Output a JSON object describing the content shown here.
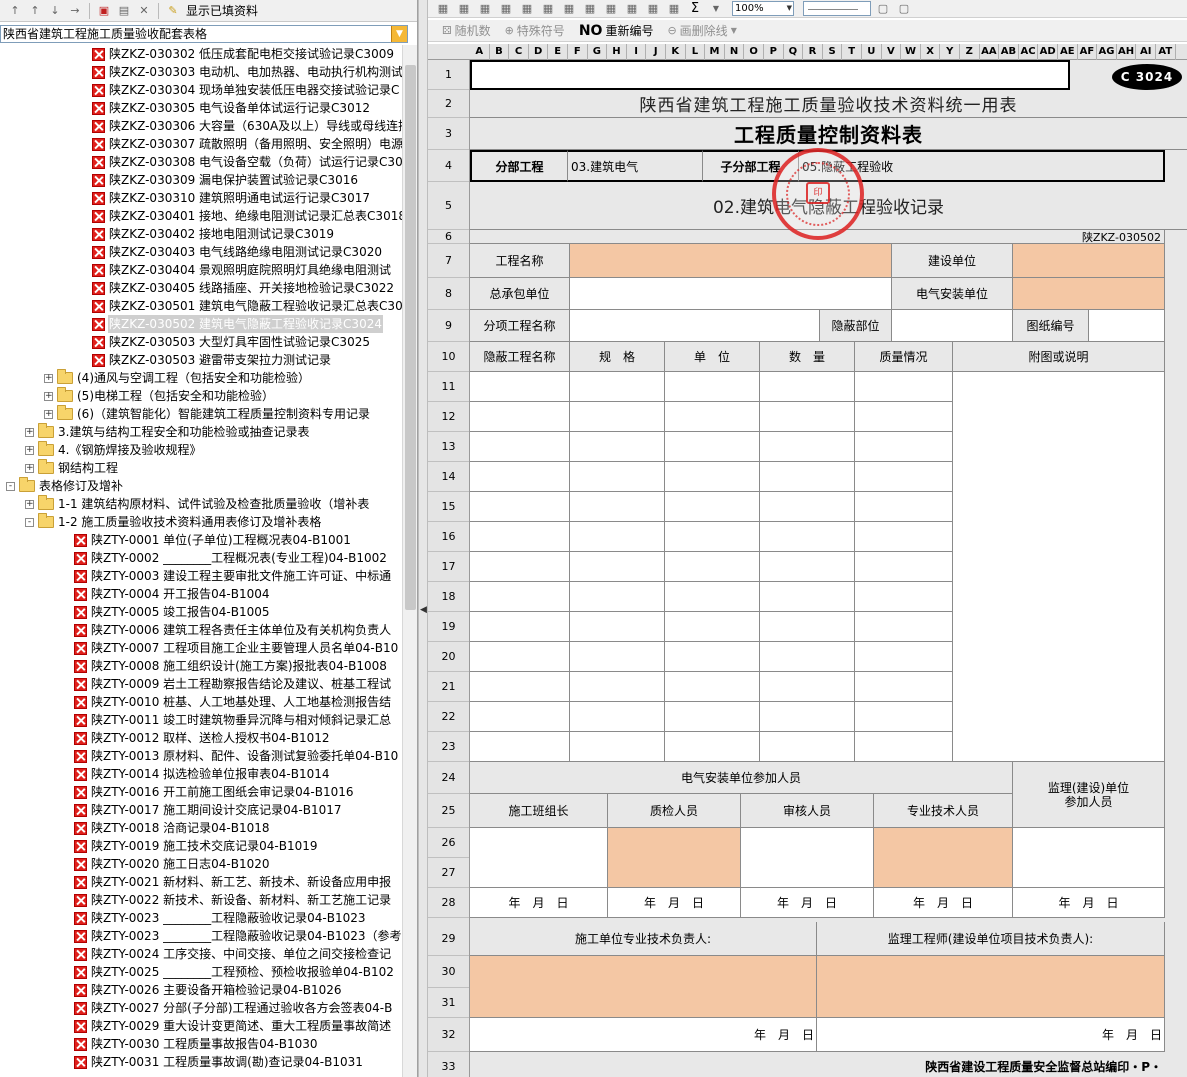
{
  "left_toolbar": {
    "show_filled_label": "显示已填资料"
  },
  "left_combo": {
    "value": "陕西省建筑工程施工质量验收配套表格"
  },
  "tree": {
    "rows": [
      {
        "kind": "doc",
        "indent": 92,
        "label": "陕ZKZ-030302 低压成套配电柜交接试验记录C3009"
      },
      {
        "kind": "doc",
        "indent": 92,
        "label": "陕ZKZ-030303 电动机、电加热器、电动执行机构测试"
      },
      {
        "kind": "doc",
        "indent": 92,
        "label": "陕ZKZ-030304 现场单独安装低压电器交接试验记录C"
      },
      {
        "kind": "doc",
        "indent": 92,
        "label": "陕ZKZ-030305 电气设备单体试运行记录C3012"
      },
      {
        "kind": "doc",
        "indent": 92,
        "label": "陕ZKZ-030306 大容量（630A及以上）导线或母线连接"
      },
      {
        "kind": "doc",
        "indent": 92,
        "label": "陕ZKZ-030307 疏散照明（备用照明、安全照明）电源"
      },
      {
        "kind": "doc",
        "indent": 92,
        "label": "陕ZKZ-030308 电气设备空载（负荷）试运行记录C30"
      },
      {
        "kind": "doc",
        "indent": 92,
        "label": "陕ZKZ-030309 漏电保护装置试验记录C3016"
      },
      {
        "kind": "doc",
        "indent": 92,
        "label": "陕ZKZ-030310 建筑照明通电试运行记录C3017"
      },
      {
        "kind": "doc",
        "indent": 92,
        "label": "陕ZKZ-030401 接地、绝缘电阻测试记录汇总表C3018"
      },
      {
        "kind": "doc",
        "indent": 92,
        "label": "陕ZKZ-030402 接地电阻测试记录C3019"
      },
      {
        "kind": "doc",
        "indent": 92,
        "label": "陕ZKZ-030403 电气线路绝缘电阻测试记录C3020"
      },
      {
        "kind": "doc",
        "indent": 92,
        "label": "陕ZKZ-030404 景观照明庭院照明灯具绝缘电阻测试"
      },
      {
        "kind": "doc",
        "indent": 92,
        "label": "陕ZKZ-030405 线路插座、开关接地检验记录C3022"
      },
      {
        "kind": "doc",
        "indent": 92,
        "label": "陕ZKZ-030501 建筑电气隐蔽工程验收记录汇总表C30"
      },
      {
        "kind": "doc",
        "indent": 92,
        "label": "陕ZKZ-030502 建筑电气隐蔽工程验收记录C3024",
        "selected": true
      },
      {
        "kind": "doc",
        "indent": 92,
        "label": "陕ZKZ-030503 大型灯具牢固性试验记录C3025"
      },
      {
        "kind": "doc",
        "indent": 92,
        "label": "陕ZKZ-030503 避雷带支架拉力测试记录"
      },
      {
        "kind": "folder",
        "indent": 58,
        "label": "(4)通风与空调工程（包括安全和功能检验）",
        "expander": "+"
      },
      {
        "kind": "folder",
        "indent": 58,
        "label": "(5)电梯工程（包括安全和功能检验）",
        "expander": "+"
      },
      {
        "kind": "folder",
        "indent": 58,
        "label": "(6)（建筑智能化）智能建筑工程质量控制资料专用记录",
        "expander": "+"
      },
      {
        "kind": "folder",
        "indent": 39,
        "label": "3.建筑与结构工程安全和功能检验或抽查记录表",
        "expander": "+"
      },
      {
        "kind": "folder",
        "indent": 39,
        "label": "4.《钢筋焊接及验收规程》",
        "expander": "+"
      },
      {
        "kind": "folder",
        "indent": 39,
        "label": "钢结构工程",
        "expander": "+"
      },
      {
        "kind": "folder-open",
        "indent": 20,
        "label": "表格修订及增补",
        "expander": "-"
      },
      {
        "kind": "folder",
        "indent": 39,
        "label": "1-1 建筑结构原材料、试件试验及检查批质量验收（增补表",
        "expander": "+"
      },
      {
        "kind": "folder-open",
        "indent": 39,
        "label": "1-2 施工质量验收技术资料通用表修订及增补表格",
        "expander": "-"
      },
      {
        "kind": "doc",
        "indent": 74,
        "label": "陕ZTY-0001 单位(子单位)工程概况表04-B1001"
      },
      {
        "kind": "doc",
        "indent": 74,
        "label": "陕ZTY-0002 ________工程概况表(专业工程)04-B1002"
      },
      {
        "kind": "doc",
        "indent": 74,
        "label": "陕ZTY-0003 建设工程主要审批文件施工许可证、中标通"
      },
      {
        "kind": "doc",
        "indent": 74,
        "label": "陕ZTY-0004 开工报告04-B1004"
      },
      {
        "kind": "doc",
        "indent": 74,
        "label": "陕ZTY-0005 竣工报告04-B1005"
      },
      {
        "kind": "doc",
        "indent": 74,
        "label": "陕ZTY-0006 建筑工程各责任主体单位及有关机构负责人"
      },
      {
        "kind": "doc",
        "indent": 74,
        "label": "陕ZTY-0007 工程项目施工企业主要管理人员名单04-B10"
      },
      {
        "kind": "doc",
        "indent": 74,
        "label": "陕ZTY-0008 施工组织设计(施工方案)报批表04-B1008"
      },
      {
        "kind": "doc",
        "indent": 74,
        "label": "陕ZTY-0009 岩土工程勘察报告结论及建议、桩基工程试"
      },
      {
        "kind": "doc",
        "indent": 74,
        "label": "陕ZTY-0010 桩基、人工地基处理、人工地基检测报告结"
      },
      {
        "kind": "doc",
        "indent": 74,
        "label": "陕ZTY-0011 竣工时建筑物垂异沉降与相对倾斜记录汇总"
      },
      {
        "kind": "doc",
        "indent": 74,
        "label": "陕ZTY-0012 取样、送检人授权书04-B1012"
      },
      {
        "kind": "doc",
        "indent": 74,
        "label": "陕ZTY-0013 原材料、配件、设备测试复验委托单04-B10"
      },
      {
        "kind": "doc",
        "indent": 74,
        "label": "陕ZTY-0014 拟选检验单位报审表04-B1014"
      },
      {
        "kind": "doc",
        "indent": 74,
        "label": "陕ZTY-0016 开工前施工图纸会审记录04-B1016"
      },
      {
        "kind": "doc",
        "indent": 74,
        "label": "陕ZTY-0017 施工期间设计交底记录04-B1017"
      },
      {
        "kind": "doc",
        "indent": 74,
        "label": "陕ZTY-0018 洽商记录04-B1018"
      },
      {
        "kind": "doc",
        "indent": 74,
        "label": "陕ZTY-0019 施工技术交底记录04-B1019"
      },
      {
        "kind": "doc",
        "indent": 74,
        "label": "陕ZTY-0020 施工日志04-B1020"
      },
      {
        "kind": "doc",
        "indent": 74,
        "label": "陕ZTY-0021 新材料、新工艺、新技术、新设备应用申报"
      },
      {
        "kind": "doc",
        "indent": 74,
        "label": "陕ZTY-0022 新技术、新设备、新材料、新工艺施工记录"
      },
      {
        "kind": "doc",
        "indent": 74,
        "label": "陕ZTY-0023 ________工程隐蔽验收记录04-B1023"
      },
      {
        "kind": "doc",
        "indent": 74,
        "label": "陕ZTY-0023 ________工程隐蔽验收记录04-B1023（参考"
      },
      {
        "kind": "doc",
        "indent": 74,
        "label": "陕ZTY-0024 工序交接、中间交接、单位之间交接检查记"
      },
      {
        "kind": "doc",
        "indent": 74,
        "label": "陕ZTY-0025 ________工程预检、预检收报验单04-B102"
      },
      {
        "kind": "doc",
        "indent": 74,
        "label": "陕ZTY-0026 主要设备开箱检验记录04-B1026"
      },
      {
        "kind": "doc",
        "indent": 74,
        "label": "陕ZTY-0027 分部(子分部)工程通过验收各方会签表04-B"
      },
      {
        "kind": "doc",
        "indent": 74,
        "label": "陕ZTY-0029 重大设计变更简述、重大工程质量事故简述"
      },
      {
        "kind": "doc",
        "indent": 74,
        "label": "陕ZTY-0030 工程质量事故报告04-B1030"
      },
      {
        "kind": "doc",
        "indent": 74,
        "label": "陕ZTY-0031 工程质量事故调(勘)查记录04-B1031"
      }
    ]
  },
  "right_toolbar": {
    "zoom": "100%",
    "sigma": "Σ",
    "random_label": "随机数",
    "special_symbol_label": "特殊符号",
    "renumber_prefix": "NO",
    "renumber_label": "重新编号",
    "strike_label": "画删除线"
  },
  "columns": [
    "A",
    "B",
    "C",
    "D",
    "E",
    "F",
    "G",
    "H",
    "I",
    "J",
    "K",
    "L",
    "M",
    "N",
    "O",
    "P",
    "Q",
    "R",
    "S",
    "T",
    "U",
    "V",
    "W",
    "X",
    "Y",
    "Z",
    "AA",
    "AB",
    "AC",
    "AD",
    "AE",
    "AF",
    "AG",
    "AH",
    "AI",
    "AT"
  ],
  "rows": [
    "1",
    "2",
    "3",
    "4",
    "5",
    "6",
    "7",
    "8",
    "9",
    "10",
    "11",
    "12",
    "13",
    "14",
    "15",
    "16",
    "17",
    "18",
    "19",
    "20",
    "21",
    "22",
    "23",
    "24",
    "25",
    "26",
    "27",
    "28",
    "29",
    "30",
    "31",
    "32",
    "33"
  ],
  "form": {
    "code_badge": "C 3024",
    "header_title": "陕西省建筑工程施工质量验收技术资料统一用表",
    "main_title": "工程质量控制资料表",
    "subdivision_label": "分部工程",
    "subdivision_value": "03.建筑电气",
    "sub_subdivision_label": "子分部工程",
    "sub_subdivision_value": "05.隐蔽工程验收",
    "record_title": "02.建筑电气隐蔽工程验收记录",
    "form_code": "陕ZKZ-030502",
    "project_name_label": "工程名称",
    "construction_unit_label": "建设单位",
    "general_contractor_label": "总承包单位",
    "electrical_install_unit_label": "电气安装单位",
    "sub_project_label": "分项工程名称",
    "hidden_location_label": "隐蔽部位",
    "drawing_no_label": "图纸编号",
    "col_hidden_name": "隐蔽工程名称",
    "col_spec": "规　格",
    "col_unit": "单　位",
    "col_qty": "数　量",
    "col_quality": "质量情况",
    "col_notes": "附图或说明",
    "personnel_header": "电气安装单位参加人员",
    "supervision_header_1": "监理(建设)单位",
    "supervision_header_2": "参加人员",
    "foreman_label": "施工班组长",
    "inspector_label": "质检人员",
    "reviewer_label": "审核人员",
    "technician_label": "专业技术人员",
    "date_label": "年　月　日",
    "contractor_tech_lead_label": "施工单位专业技术负责人:",
    "supervisor_label": "监理工程师(建设单位项目技术负责人):",
    "footer": "陕西省建设工程质量安全监督总站编印・P・"
  }
}
